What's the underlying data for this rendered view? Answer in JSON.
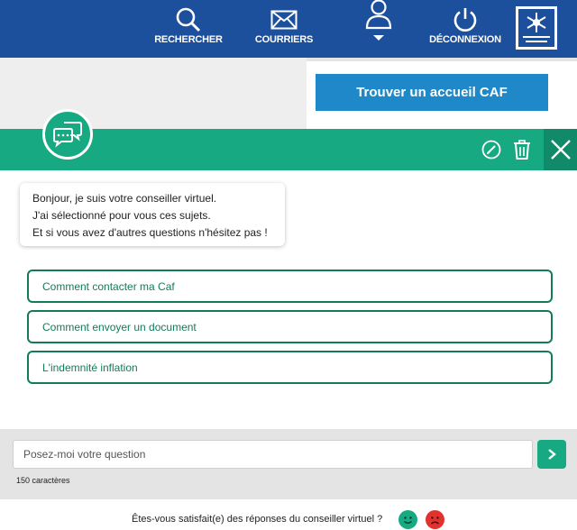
{
  "nav": {
    "items": [
      {
        "label": "RECHERCHER",
        "icon": "search-icon"
      },
      {
        "label": "COURRIERS",
        "icon": "mail-icon"
      },
      {
        "label": "",
        "icon": "user-account-icon"
      },
      {
        "label": "DÉCONNEXION",
        "icon": "power-icon"
      }
    ],
    "logo_text": "ALLOCATIONS FAMILIALES"
  },
  "page": {
    "cta_label": "Trouver un accueil CAF"
  },
  "chat": {
    "header_icons": [
      "chat-bubbles-icon",
      "edit-icon",
      "trash-icon",
      "close-icon"
    ],
    "greeting": [
      "Bonjour, je suis votre conseiller virtuel.",
      "J'ai sélectionné pour vous ces sujets.",
      "Et si vous avez d'autres questions n'hésitez pas !"
    ],
    "options": [
      "Comment contacter ma Caf",
      "Comment envoyer un document",
      "L'indemnité inflation"
    ],
    "input_placeholder": "Posez-moi votre question",
    "char_count": "150 caractères",
    "satisfaction_question": "Êtes-vous satisfait(e) des réponses du conseiller virtuel ?"
  },
  "colors": {
    "nav_blue": "#1c4f9c",
    "chat_green": "#17a981",
    "option_green": "#147a5c",
    "cta_blue": "#1f88c8",
    "sad_red": "#e0322f"
  }
}
